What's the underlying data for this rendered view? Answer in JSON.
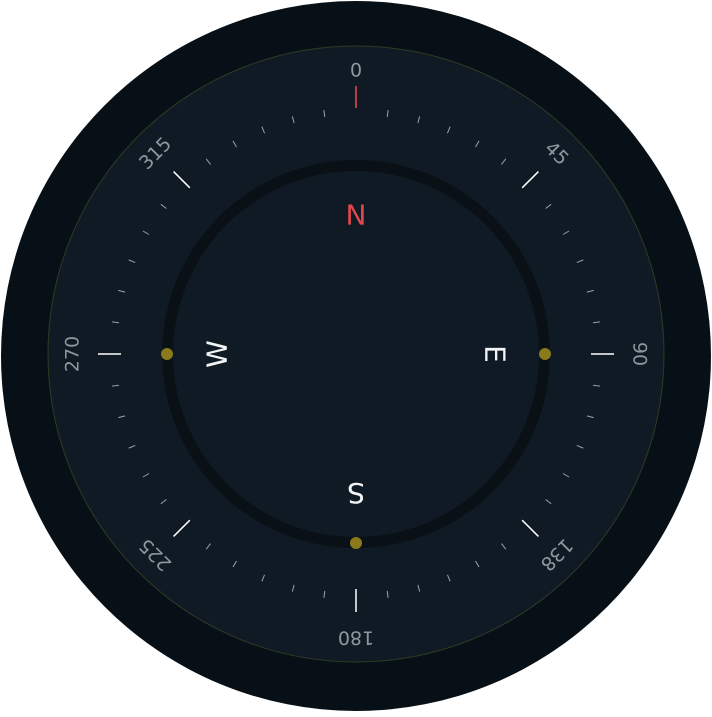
{
  "compass": {
    "degree_labels": [
      {
        "text": "0",
        "angle": 0
      },
      {
        "text": "45",
        "angle": 45
      },
      {
        "text": "90",
        "angle": 90
      },
      {
        "text": "138",
        "angle": 135
      },
      {
        "text": "180",
        "angle": 180
      },
      {
        "text": "225",
        "angle": 225
      },
      {
        "text": "270",
        "angle": 270
      },
      {
        "text": "315",
        "angle": 315
      }
    ],
    "cardinals": [
      {
        "text": "N",
        "angle": 0,
        "color": "#e0474c"
      },
      {
        "text": "E",
        "angle": 90,
        "color": "#f2f4f6"
      },
      {
        "text": "S",
        "angle": 180,
        "color": "#f2f4f6"
      },
      {
        "text": "W",
        "angle": 270,
        "color": "#f2f4f6"
      }
    ],
    "marker_angles": [
      90,
      180,
      270
    ],
    "tick_step_deg": 7.5,
    "colors": {
      "outer_background": "#071016",
      "dial_face": "#0f1a24",
      "ring_track": "#0a1116",
      "inner_face": "#0f1a24",
      "north_tick": "#e0474c",
      "major_tick": "#ffffff",
      "minor_tick": "#9aa3aa",
      "degree_label": "#8f979e",
      "marker_dot": "#8a7a1c",
      "rim_line": "#2f3a24"
    }
  }
}
